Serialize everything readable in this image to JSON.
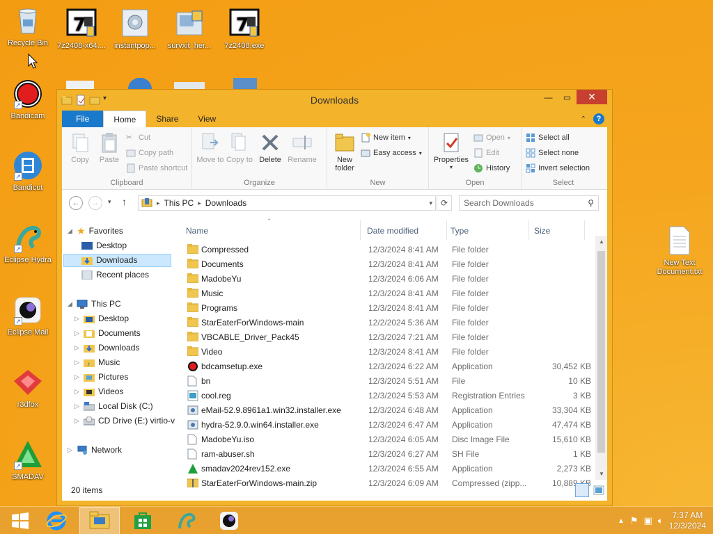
{
  "desktop": {
    "icons": [
      {
        "label": "Recycle Bin"
      },
      {
        "label": "7z2408-x64...."
      },
      {
        "label": "instantpop..."
      },
      {
        "label": "survxit_her..."
      },
      {
        "label": "7z2408.exe"
      },
      {
        "label": "Bandicam"
      },
      {
        "label": "Bandicut"
      },
      {
        "label": "Eclipse Hydra"
      },
      {
        "label": "Eclipse Mail"
      },
      {
        "label": "r3dfox"
      },
      {
        "label": "SMADAV"
      },
      {
        "label": "New Text Document.txt"
      }
    ]
  },
  "window": {
    "title": "Downloads",
    "tabs": [
      "File",
      "Home",
      "Share",
      "View"
    ],
    "ribbon": {
      "clipboard": {
        "label": "Clipboard",
        "copy": "Copy",
        "paste": "Paste",
        "cut": "Cut",
        "copy_path": "Copy path",
        "paste_shortcut": "Paste shortcut"
      },
      "organize": {
        "label": "Organize",
        "move_to": "Move to",
        "copy_to": "Copy to",
        "delete": "Delete",
        "rename": "Rename"
      },
      "new": {
        "label": "New",
        "new_folder": "New folder",
        "new_item": "New item",
        "easy_access": "Easy access"
      },
      "open": {
        "label": "Open",
        "properties": "Properties",
        "open": "Open",
        "edit": "Edit",
        "history": "History"
      },
      "select": {
        "label": "Select",
        "select_all": "Select all",
        "select_none": "Select none",
        "invert": "Invert selection"
      }
    },
    "address": {
      "path": [
        "This PC",
        "Downloads"
      ],
      "search_placeholder": "Search Downloads"
    },
    "nav": {
      "favorites": "Favorites",
      "fav_items": [
        "Desktop",
        "Downloads",
        "Recent places"
      ],
      "this_pc": "This PC",
      "pc_items": [
        "Desktop",
        "Documents",
        "Downloads",
        "Music",
        "Pictures",
        "Videos",
        "Local Disk (C:)",
        "CD Drive (E:) virtio-v"
      ],
      "network": "Network"
    },
    "columns": {
      "name": "Name",
      "date": "Date modified",
      "type": "Type",
      "size": "Size"
    },
    "files": [
      {
        "name": "Compressed",
        "date": "12/3/2024 8:41 AM",
        "type": "File folder",
        "size": "",
        "kind": "folder"
      },
      {
        "name": "Documents",
        "date": "12/3/2024 8:41 AM",
        "type": "File folder",
        "size": "",
        "kind": "folder"
      },
      {
        "name": "MadobeYu",
        "date": "12/3/2024 6:06 AM",
        "type": "File folder",
        "size": "",
        "kind": "folder"
      },
      {
        "name": "Music",
        "date": "12/3/2024 8:41 AM",
        "type": "File folder",
        "size": "",
        "kind": "folder"
      },
      {
        "name": "Programs",
        "date": "12/3/2024 8:41 AM",
        "type": "File folder",
        "size": "",
        "kind": "folder"
      },
      {
        "name": "StarEaterForWindows-main",
        "date": "12/2/2024 5:36 AM",
        "type": "File folder",
        "size": "",
        "kind": "folder"
      },
      {
        "name": "VBCABLE_Driver_Pack45",
        "date": "12/3/2024 7:21 AM",
        "type": "File folder",
        "size": "",
        "kind": "folder"
      },
      {
        "name": "Video",
        "date": "12/3/2024 8:41 AM",
        "type": "File folder",
        "size": "",
        "kind": "folder"
      },
      {
        "name": "bdcamsetup.exe",
        "date": "12/3/2024 6:22 AM",
        "type": "Application",
        "size": "30,452 KB",
        "kind": "bdcam"
      },
      {
        "name": "bn",
        "date": "12/3/2024 5:51 AM",
        "type": "File",
        "size": "10 KB",
        "kind": "file"
      },
      {
        "name": "cool.reg",
        "date": "12/3/2024 5:53 AM",
        "type": "Registration Entries",
        "size": "3 KB",
        "kind": "reg"
      },
      {
        "name": "eMail-52.9.8961a1.win32.installer.exe",
        "date": "12/3/2024 6:48 AM",
        "type": "Application",
        "size": "33,304 KB",
        "kind": "app"
      },
      {
        "name": "hydra-52.9.0.win64.installer.exe",
        "date": "12/3/2024 6:47 AM",
        "type": "Application",
        "size": "47,474 KB",
        "kind": "app"
      },
      {
        "name": "MadobeYu.iso",
        "date": "12/3/2024 6:05 AM",
        "type": "Disc Image File",
        "size": "15,610 KB",
        "kind": "file"
      },
      {
        "name": "ram-abuser.sh",
        "date": "12/3/2024 6:27 AM",
        "type": "SH File",
        "size": "1 KB",
        "kind": "file"
      },
      {
        "name": "smadav2024rev152.exe",
        "date": "12/3/2024 6:55 AM",
        "type": "Application",
        "size": "2,273 KB",
        "kind": "smadav"
      },
      {
        "name": "StarEaterForWindows-main.zip",
        "date": "12/3/2024 6:09 AM",
        "type": "Compressed (zipp...",
        "size": "10,889 KB",
        "kind": "zip"
      }
    ],
    "status": "20 items"
  },
  "taskbar": {
    "time": "7:37 AM",
    "date": "12/3/2024"
  }
}
